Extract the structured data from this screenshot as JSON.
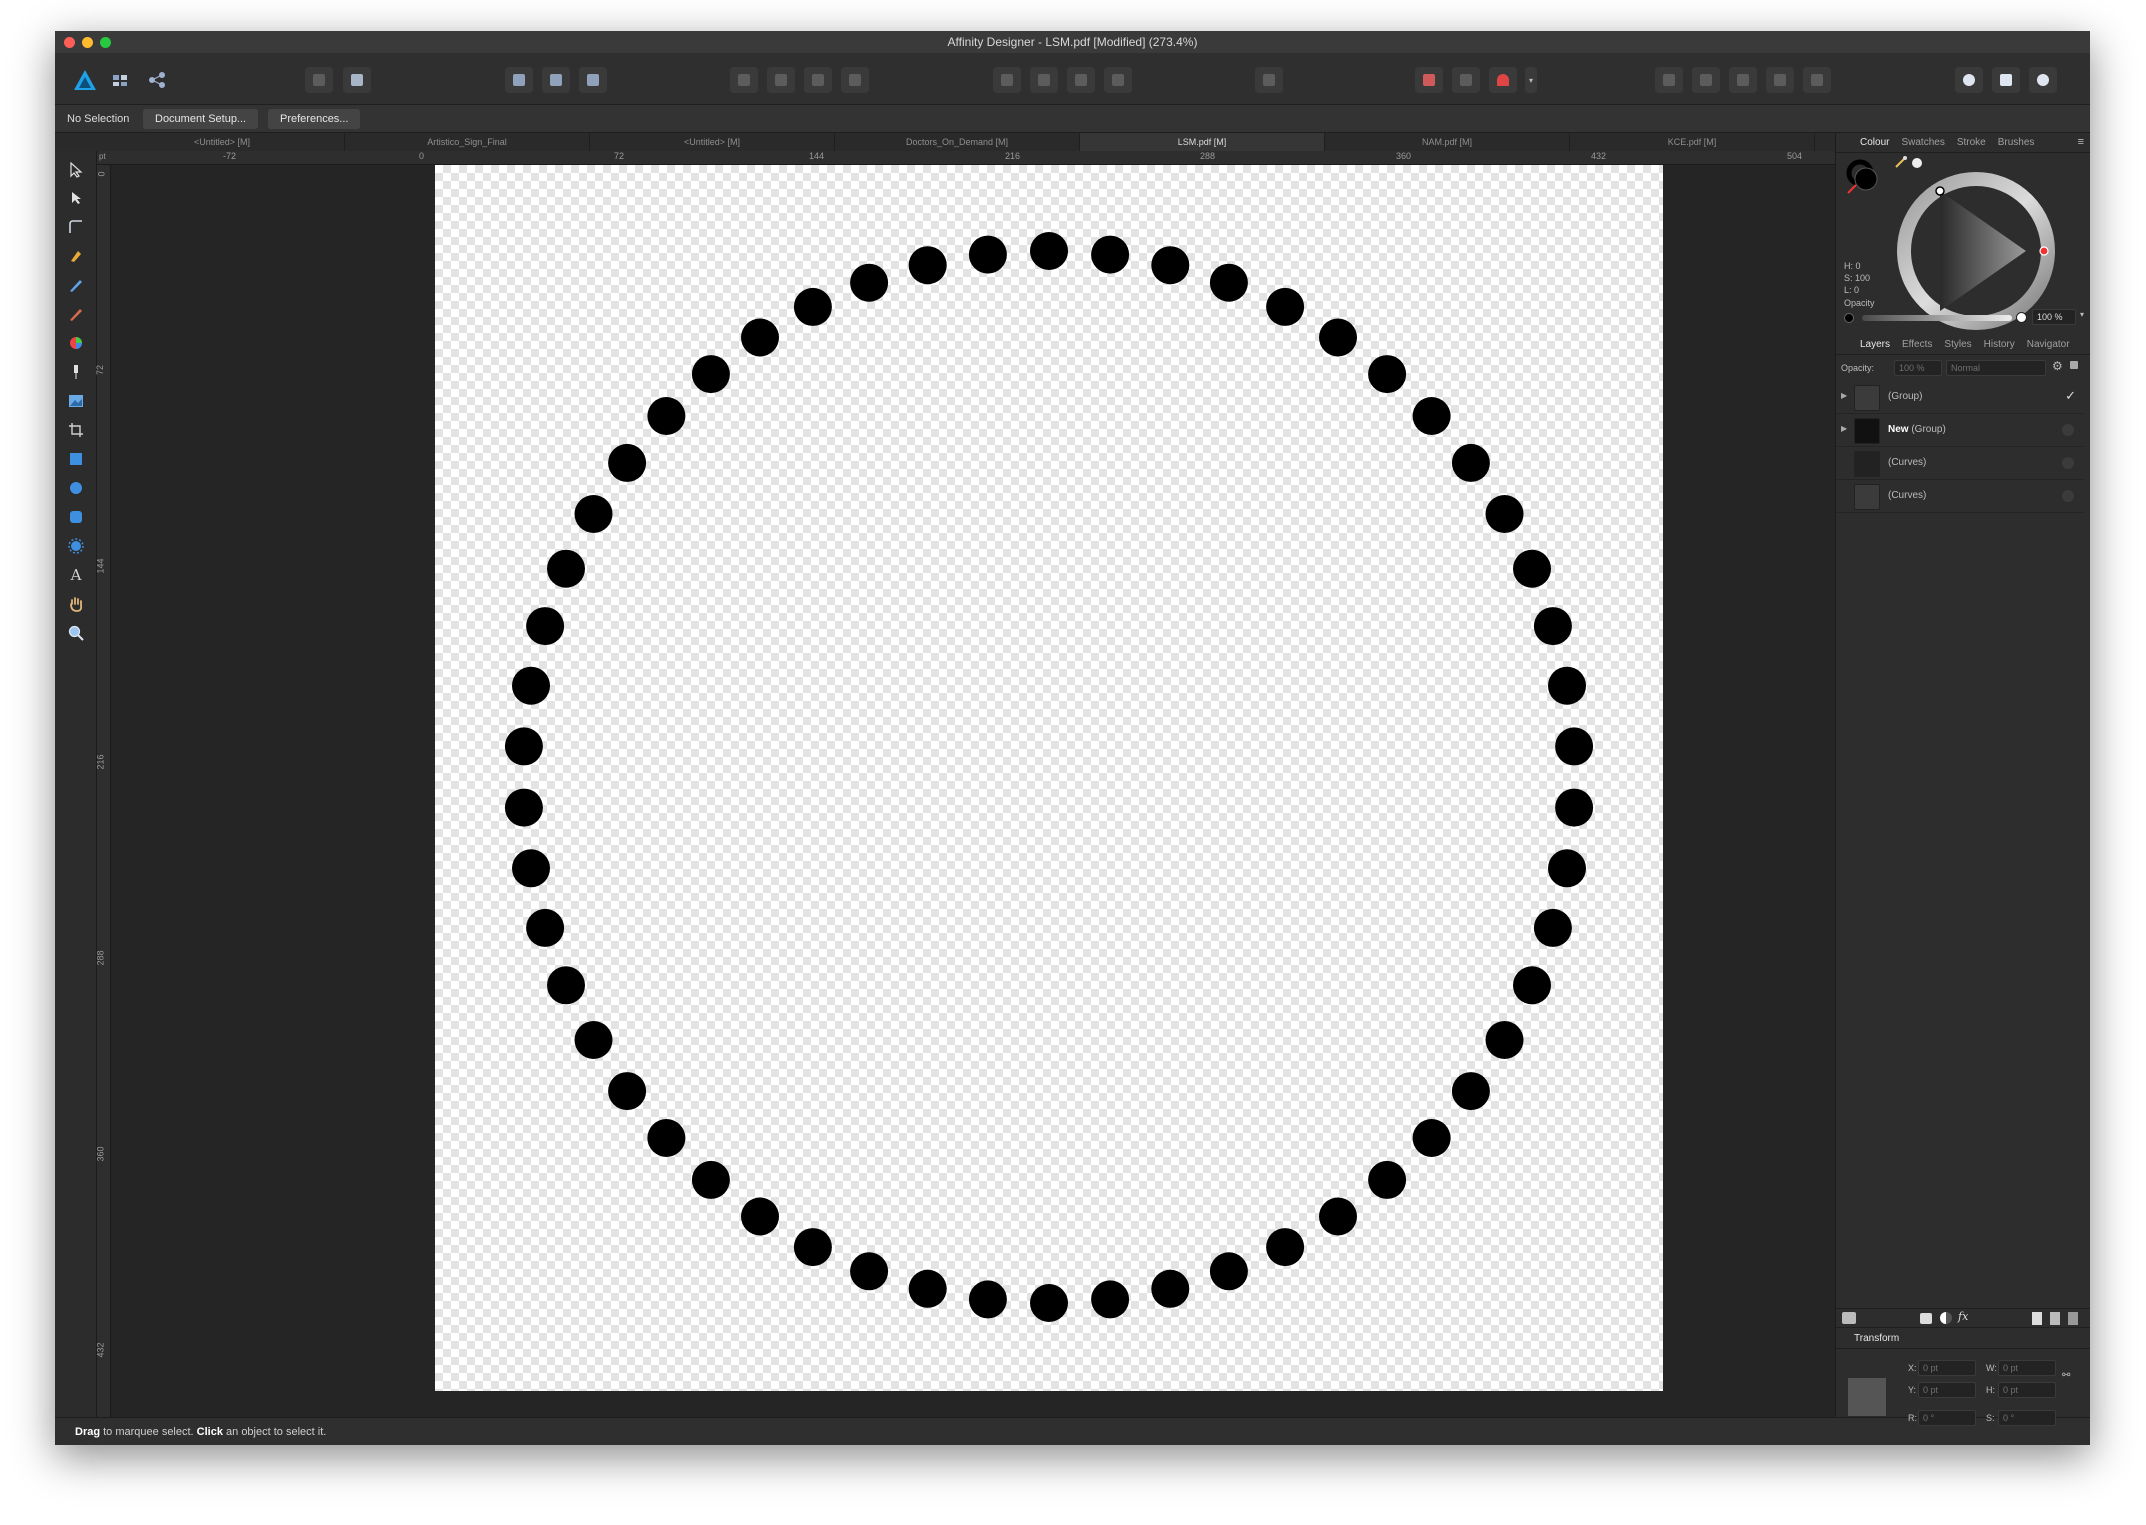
{
  "window": {
    "title": "Affinity Designer - LSM.pdf [Modified] (273.4%)"
  },
  "context": {
    "status_label": "No Selection",
    "doc_setup": "Document Setup...",
    "preferences": "Preferences..."
  },
  "tabs": [
    "<Untitled> [M]",
    "Artistico_Sign_Final",
    "<Untitled> [M]",
    "Doctors_On_Demand [M]",
    "LSM.pdf [M]",
    "NAM.pdf [M]",
    "KCE.pdf [M]"
  ],
  "active_tab_index": 4,
  "ruler": {
    "unit": "pt",
    "h_ticks": [
      "-72",
      "0",
      "72",
      "144",
      "216",
      "288",
      "360",
      "432",
      "504"
    ],
    "v_ticks": [
      "0",
      "72",
      "144",
      "216",
      "288",
      "360",
      "432"
    ]
  },
  "colour_panel": {
    "tabs": [
      "Colour",
      "Swatches",
      "Stroke",
      "Brushes"
    ],
    "h": "H: 0",
    "s": "S: 100",
    "l": "L: 0",
    "opacity_label": "Opacity",
    "opacity_value": "100 %"
  },
  "layers_panel": {
    "tabs": [
      "Layers",
      "Effects",
      "Styles",
      "History",
      "Navigator"
    ],
    "opacity_label": "Opacity:",
    "opacity_value": "100 %",
    "blend_mode": "Normal",
    "layers": [
      {
        "bold": "",
        "name": "(Group)"
      },
      {
        "bold": "New",
        "name": " (Group)"
      },
      {
        "bold": "",
        "name": "(Curves)"
      },
      {
        "bold": "",
        "name": "(Curves)"
      }
    ]
  },
  "transform_panel": {
    "title": "Transform",
    "x_label": "X:",
    "x_value": "0 pt",
    "y_label": "Y:",
    "y_value": "0 pt",
    "w_label": "W:",
    "w_value": "0 pt",
    "h_label": "H:",
    "h_value": "0 pt",
    "r_label": "R:",
    "r_value": "0 °",
    "s_label": "S:",
    "s_value": "0 °"
  },
  "statusbar": {
    "drag": "Drag",
    "drag_text": " to marquee select. ",
    "click": "Click",
    "click_text": " an object to select it."
  },
  "artwork": {
    "shape": "ring of dots",
    "dot_count": 54,
    "dot_color": "#000000"
  },
  "colors": {
    "traffic_close": "#ff5f57",
    "traffic_min": "#febc2e",
    "traffic_max": "#28c840",
    "accent": "#1ea1e6"
  }
}
